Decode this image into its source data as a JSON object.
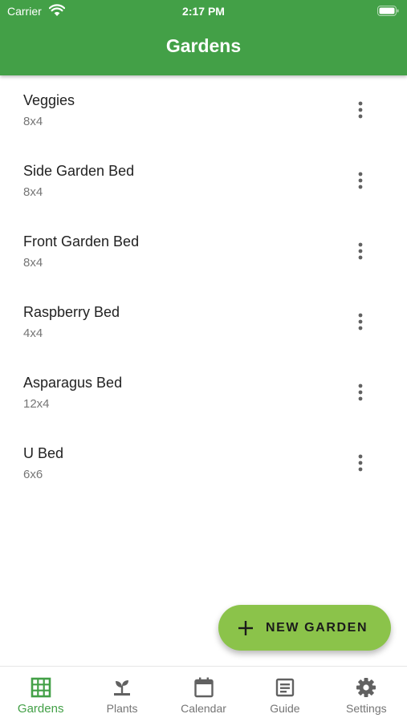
{
  "status_bar": {
    "carrier": "Carrier",
    "time": "2:17 PM"
  },
  "app_bar": {
    "title": "Gardens"
  },
  "gardens": [
    {
      "name": "Veggies",
      "size": "8x4"
    },
    {
      "name": "Side Garden Bed",
      "size": "8x4"
    },
    {
      "name": "Front Garden Bed",
      "size": "8x4"
    },
    {
      "name": "Raspberry Bed",
      "size": "4x4"
    },
    {
      "name": "Asparagus Bed",
      "size": "12x4"
    },
    {
      "name": "U Bed",
      "size": "6x6"
    }
  ],
  "fab": {
    "label": "NEW GARDEN",
    "icon": "plus-icon"
  },
  "bottom_nav": {
    "active": "Gardens",
    "items": [
      {
        "label": "Gardens",
        "icon": "grid-icon"
      },
      {
        "label": "Plants",
        "icon": "sprout-icon"
      },
      {
        "label": "Calendar",
        "icon": "calendar-icon"
      },
      {
        "label": "Guide",
        "icon": "article-icon"
      },
      {
        "label": "Settings",
        "icon": "gear-icon"
      }
    ]
  },
  "colors": {
    "primary": "#43a047",
    "accent": "#8bc34a",
    "text_primary": "#222222",
    "text_secondary": "#757575"
  }
}
